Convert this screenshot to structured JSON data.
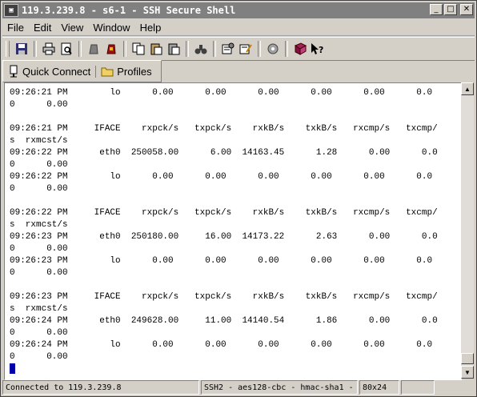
{
  "window": {
    "title": "119.3.239.8 - s6-1 - SSH Secure Shell"
  },
  "menu": [
    "File",
    "Edit",
    "View",
    "Window",
    "Help"
  ],
  "toolbar_icons": [
    "save-icon",
    "print-icon",
    "print-preview-icon",
    "disconnect-icon",
    "new-terminal-icon",
    "copy-icon",
    "paste-icon",
    "paste-alt-icon",
    "find-icon",
    "settings-icon",
    "profile-edit-icon",
    "file-transfer-icon",
    "help-book-icon",
    "context-help-icon"
  ],
  "toolbar2": {
    "quick_connect": "Quick Connect",
    "profiles": "Profiles"
  },
  "terminal": {
    "lines": [
      "09:26:21 PM        lo      0.00      0.00      0.00      0.00      0.00      0.0",
      "0      0.00",
      "",
      "09:26:21 PM     IFACE    rxpck/s   txpck/s    rxkB/s    txkB/s   rxcmp/s   txcmp/",
      "s  rxmcst/s",
      "09:26:22 PM      eth0  250058.00      6.00  14163.45      1.28      0.00      0.0",
      "0      0.00",
      "09:26:22 PM        lo      0.00      0.00      0.00      0.00      0.00      0.0",
      "0      0.00",
      "",
      "09:26:22 PM     IFACE    rxpck/s   txpck/s    rxkB/s    txkB/s   rxcmp/s   txcmp/",
      "s  rxmcst/s",
      "09:26:23 PM      eth0  250180.00     16.00  14173.22      2.63      0.00      0.0",
      "0      0.00",
      "09:26:23 PM        lo      0.00      0.00      0.00      0.00      0.00      0.0",
      "0      0.00",
      "",
      "09:26:23 PM     IFACE    rxpck/s   txpck/s    rxkB/s    txkB/s   rxcmp/s   txcmp/",
      "s  rxmcst/s",
      "09:26:24 PM      eth0  249628.00     11.00  14140.54      1.86      0.00      0.0",
      "0      0.00",
      "09:26:24 PM        lo      0.00      0.00      0.00      0.00      0.00      0.0",
      "0      0.00"
    ]
  },
  "status": {
    "connection": "Connected to 119.3.239.8",
    "cipher": "SSH2 - aes128-cbc - hmac-sha1 - ",
    "size": "80x24"
  }
}
